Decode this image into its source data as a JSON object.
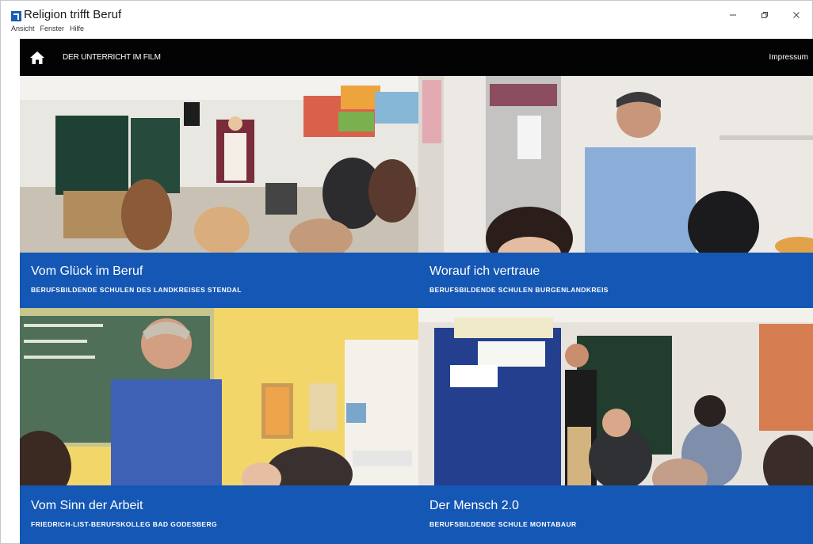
{
  "window": {
    "title": "Religion trifft Beruf",
    "menu": [
      "Ansicht",
      "Fenster",
      "Hilfe"
    ],
    "controls": [
      "minimize",
      "restore",
      "close"
    ]
  },
  "navbar": {
    "home_icon": "home-icon",
    "link_label": "DER UNTERRICHT IM FILM",
    "impressum_label": "Impressum"
  },
  "tiles": [
    {
      "title": "Vom Glück im Beruf",
      "subtitle": "BERUFSBILDENDE SCHULEN DES LANDKREISES STENDAL"
    },
    {
      "title": "Worauf ich vertraue",
      "subtitle": "BERUFSBILDENDE SCHULEN BURGENLANDKREIS"
    },
    {
      "title": "Vom Sinn der Arbeit",
      "subtitle": "FRIEDRICH-LIST-BERUFSKOLLEG BAD GODESBERG"
    },
    {
      "title": "Der Mensch 2.0",
      "subtitle": "BERUFSBILDENDE SCHULE MONTABAUR"
    }
  ],
  "colors": {
    "accent_blue": "#1557b4",
    "navbar_bg": "#030303"
  }
}
